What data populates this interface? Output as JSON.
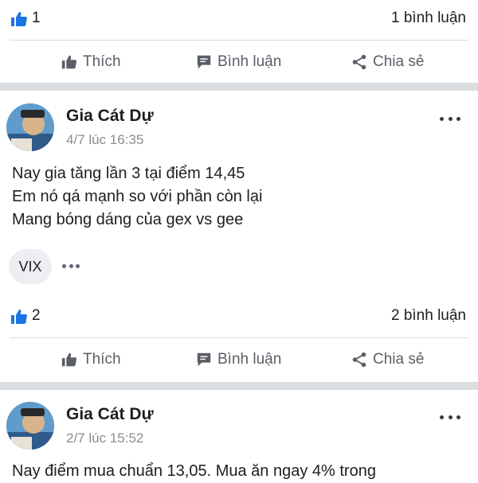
{
  "colors": {
    "accent": "#1b74e4",
    "muted_text": "#8a8d91",
    "separator": "#dadde1"
  },
  "actions": {
    "like": "Thích",
    "comment": "Bình luận",
    "share": "Chia sẻ"
  },
  "prev_post": {
    "like_count": "1",
    "comment_count": "1 bình luận"
  },
  "post1": {
    "author": "Gia Cát Dự",
    "time": "4/7 lúc 16:35",
    "lines": [
      "Nay gia tăng lần 3 tại điểm 14,45",
      "Em nó qá mạnh so với phần còn lại",
      "Mang bóng dáng của gex vs gee"
    ],
    "tag": "VIX",
    "like_count": "2",
    "comment_count": "2 bình luận"
  },
  "post2": {
    "author": "Gia Cát Dự",
    "time": "2/7 lúc 15:52",
    "lines": [
      "Nay điểm mua chuẩn 13,05. Mua ăn ngay 4% trong"
    ]
  },
  "icons": {
    "like": "thumbs-up-icon",
    "comment": "comment-bubble-icon",
    "share": "share-icon",
    "more": "more-dots-icon"
  }
}
